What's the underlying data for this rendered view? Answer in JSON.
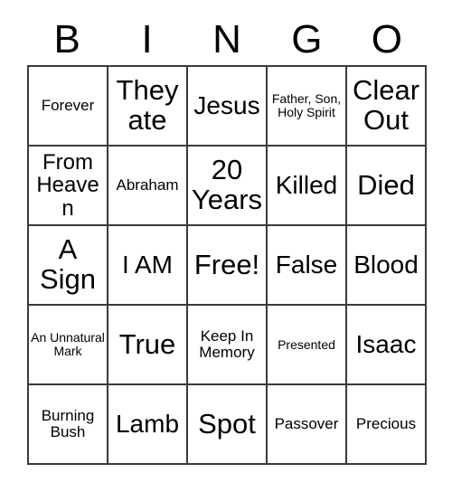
{
  "card": {
    "headers": [
      "B",
      "I",
      "N",
      "G",
      "O"
    ],
    "rows": [
      [
        {
          "text": "Forever",
          "size": "fs-sm"
        },
        {
          "text": "They ate",
          "size": "fs-xl"
        },
        {
          "text": "Jesus",
          "size": "fs-lg"
        },
        {
          "text": "Father, Son, Holy Spirit",
          "size": "fs-xs"
        },
        {
          "text": "Clear Out",
          "size": "fs-xl"
        }
      ],
      [
        {
          "text": "From Heaven",
          "size": "fs-md"
        },
        {
          "text": "Abraham",
          "size": "fs-sm"
        },
        {
          "text": "20 Years",
          "size": "fs-xl"
        },
        {
          "text": "Killed",
          "size": "fs-lg"
        },
        {
          "text": "Died",
          "size": "fs-xl"
        }
      ],
      [
        {
          "text": "A Sign",
          "size": "fs-xl"
        },
        {
          "text": "I AM",
          "size": "fs-lg"
        },
        {
          "text": "Free!",
          "size": "fs-xl"
        },
        {
          "text": "False",
          "size": "fs-lg"
        },
        {
          "text": "Blood",
          "size": "fs-lg"
        }
      ],
      [
        {
          "text": "An Unnatural Mark",
          "size": "fs-xs"
        },
        {
          "text": "True",
          "size": "fs-xl"
        },
        {
          "text": "Keep In Memory",
          "size": "fs-sm"
        },
        {
          "text": "Presented",
          "size": "fs-xs"
        },
        {
          "text": "Isaac",
          "size": "fs-lg"
        }
      ],
      [
        {
          "text": "Burning Bush",
          "size": "fs-sm"
        },
        {
          "text": "Lamb",
          "size": "fs-lg"
        },
        {
          "text": "Spot",
          "size": "fs-xl"
        },
        {
          "text": "Passover",
          "size": "fs-sm"
        },
        {
          "text": "Precious",
          "size": "fs-sm"
        }
      ]
    ]
  },
  "colors": {
    "border": "#3a3a3a",
    "text": "#000000",
    "background": "#ffffff"
  }
}
